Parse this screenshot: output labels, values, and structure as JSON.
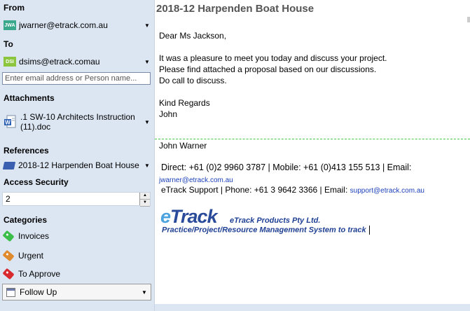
{
  "sidebar": {
    "from_label": "From",
    "from": {
      "initials": "JWA",
      "email": "jwarner@etrack.com.au",
      "avatar_color": "#3aa88c"
    },
    "to_label": "To",
    "to": {
      "initials": "DSI",
      "email": "dsims@etrack.comau",
      "avatar_color": "#8cc63f"
    },
    "email_input_placeholder": "Enter email address or Person name...",
    "attachments_label": "Attachments",
    "attachment": {
      "name": ".1 SW-10 Architects Instruction (11).doc",
      "icon": "word-doc-icon"
    },
    "references_label": "References",
    "reference": {
      "name": "2018-12 Harpenden Boat House",
      "icon": "folder-icon"
    },
    "access_security_label": "Access Security",
    "access_security_value": "2",
    "categories_label": "Categories",
    "categories": [
      {
        "name": "Invoices",
        "color": "#3cbf4a",
        "icon": "tag-icon"
      },
      {
        "name": "Urgent",
        "color": "#e08a2e",
        "icon": "tag-icon"
      },
      {
        "name": "To Approve",
        "color": "#d8292f",
        "icon": "tag-icon"
      }
    ],
    "followup": {
      "label": "Follow Up",
      "icon": "calendar-icon"
    }
  },
  "message": {
    "subject": "2018-12 Harpenden Boat House",
    "greeting": "Dear Ms Jackson,",
    "line1": "It was a pleasure to meet you today and discuss your project.",
    "line2": "Please find attached a proposal based on our discussions.",
    "line3": "Do call to discuss.",
    "closing": "Kind Regards",
    "signoff": "John"
  },
  "signature": {
    "name": "John Warner",
    "direct": "Direct:  +61 (0)2 9960 3787 |  Mobile: +61 (0)413 155 513 |  Email:",
    "email": "jwarner@etrack.com.au",
    "support": "eTrack Support | Phone: +61 3 9642 3366 | Email:",
    "support_email": "support@etrack.com.au",
    "logo_e": "e",
    "logo_track": "Track",
    "company": "eTrack Products Pty Ltd.",
    "tagline": "Practice/Project/Resource Management System to track"
  }
}
